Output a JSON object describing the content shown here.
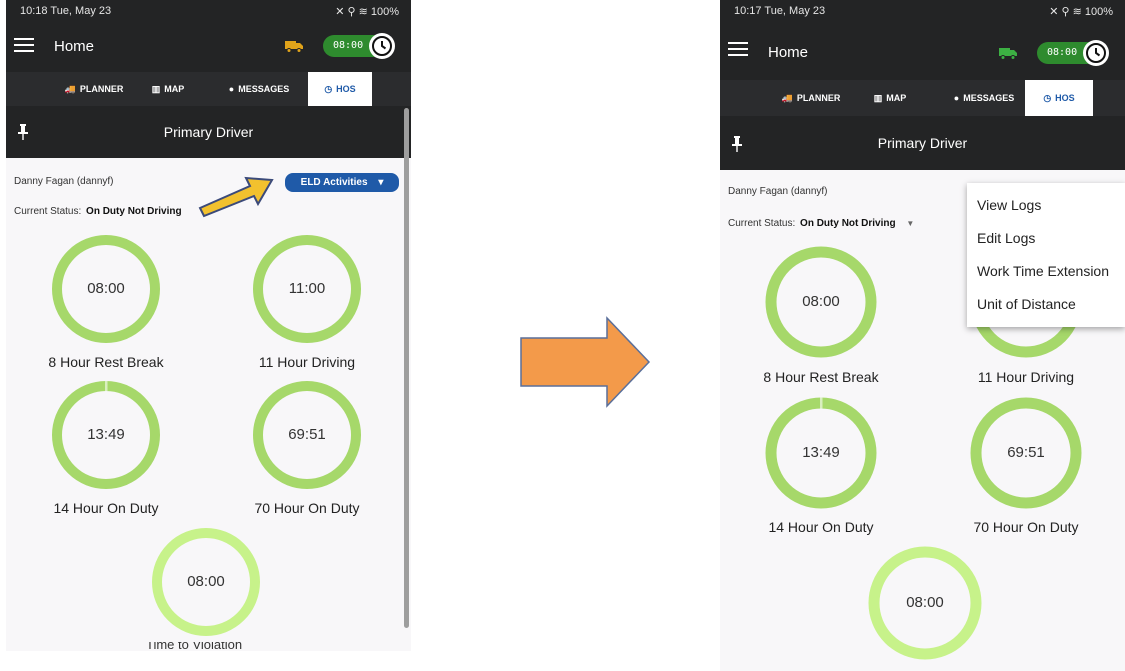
{
  "colors": {
    "appbar": "#232425",
    "tab_active_text": "#1f5aa8",
    "button_blue": "#1f5aa8",
    "hos_pill_green": "#2e8b2e",
    "ring_green": "#a6d86a",
    "ring_light_green": "#c7f28a",
    "truck_left": "#e0a31a",
    "truck_right": "#3cb043",
    "transition_arrow": "#f39a4a",
    "pointer_arrow": "#f2c12e"
  },
  "left": {
    "status": {
      "time_date": "10:18  Tue, May 23",
      "icons": "✕ ⚲ ≋ 100%"
    },
    "app": {
      "title": "Home",
      "hos_time": "08:00",
      "truck_icon": "truck-icon",
      "clock_icon": "clock-icon"
    },
    "tabs": [
      {
        "icon": "🚚",
        "label": "PLANNER"
      },
      {
        "icon": "▥",
        "label": "MAP"
      },
      {
        "icon": "●",
        "label": "MESSAGES"
      },
      {
        "icon": "◷",
        "label": "HOS"
      }
    ],
    "driver_bar": {
      "title": "Primary Driver"
    },
    "driver": {
      "name": "Danny Fagan  (dannyf)",
      "status_label": "Current Status:",
      "status_value": "On Duty Not Driving"
    },
    "eld_button": {
      "label": "ELD Activities",
      "caret": "▾"
    },
    "gauges": [
      {
        "value": "08:00",
        "label": "8 Hour Rest Break",
        "progress": 1.0
      },
      {
        "value": "11:00",
        "label": "11 Hour Driving",
        "progress": 1.0
      },
      {
        "value": "13:49",
        "label": "14 Hour On Duty",
        "progress": 0.99
      },
      {
        "value": "69:51",
        "label": "70 Hour On Duty",
        "progress": 0.998
      },
      {
        "value": "08:00",
        "label": "Time to Violation",
        "progress": 1.0
      }
    ],
    "cutoff_text": "Time to Violation"
  },
  "right": {
    "status": {
      "time_date": "10:17  Tue, May 23",
      "icons": "✕ ⚲ ≋ 100%"
    },
    "app": {
      "title": "Home",
      "hos_time": "08:00"
    },
    "tabs": [
      {
        "icon": "🚚",
        "label": "PLANNER"
      },
      {
        "icon": "▥",
        "label": "MAP"
      },
      {
        "icon": "●",
        "label": "MESSAGES"
      },
      {
        "icon": "◷",
        "label": "HOS"
      }
    ],
    "driver_bar": {
      "title": "Primary Driver"
    },
    "driver": {
      "name": "Danny Fagan  (dannyf)",
      "status_label": "Current Status:",
      "status_value": "On Duty Not Driving"
    },
    "menu": [
      "View Logs",
      "Edit Logs",
      "Work Time Extension",
      "Unit of Distance"
    ],
    "gauges": [
      {
        "value": "08:00",
        "label": "8 Hour Rest Break",
        "progress": 1.0
      },
      {
        "value": "",
        "label": "11 Hour Driving",
        "progress": 1.0
      },
      {
        "value": "13:49",
        "label": "14 Hour On Duty",
        "progress": 0.99
      },
      {
        "value": "69:51",
        "label": "70 Hour On Duty",
        "progress": 0.998
      },
      {
        "value": "08:00",
        "label": "",
        "progress": 1.0
      }
    ]
  }
}
